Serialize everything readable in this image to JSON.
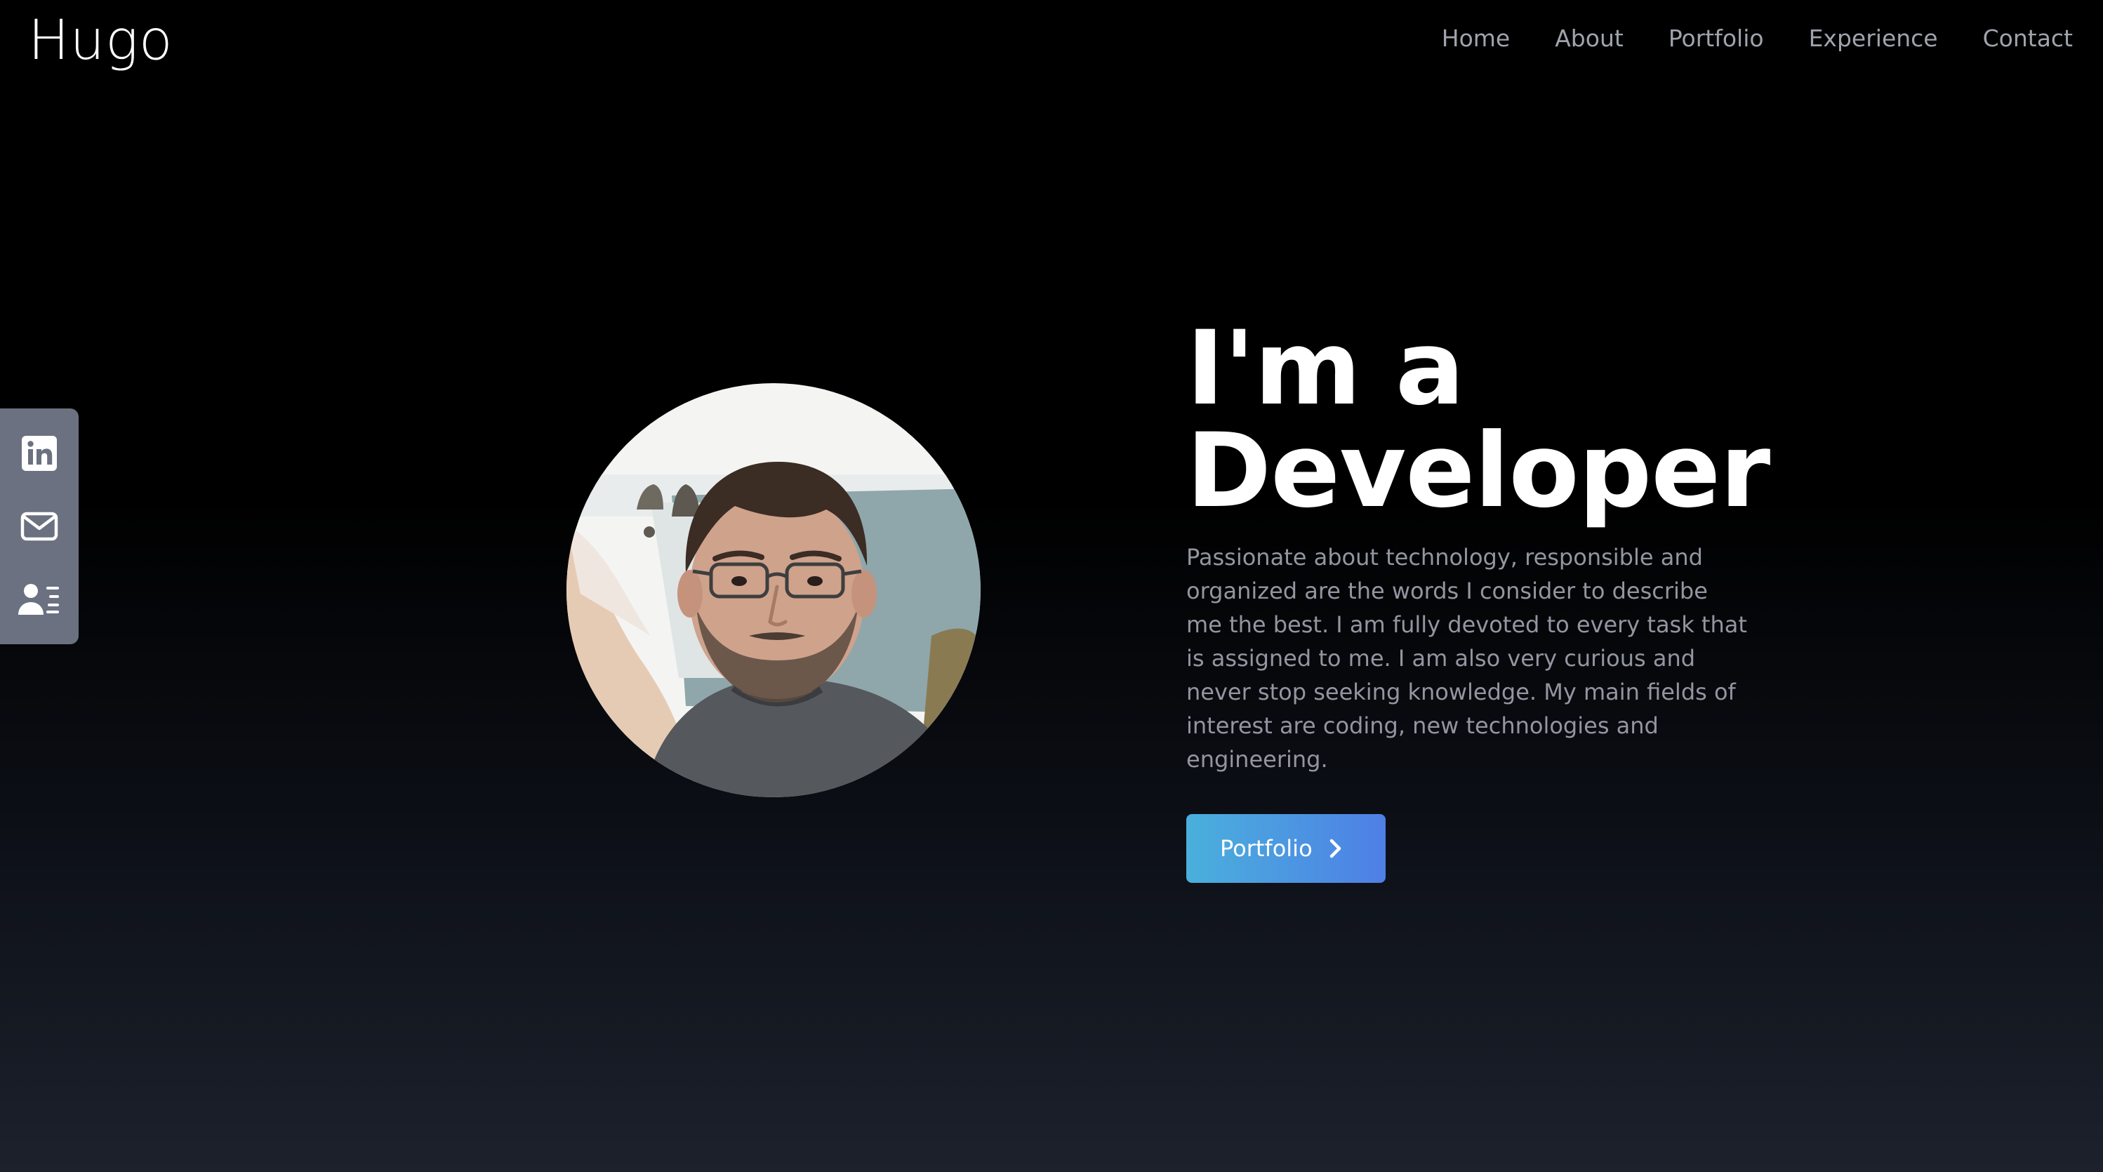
{
  "header": {
    "brand": "Hugo",
    "nav": [
      "Home",
      "About",
      "Portfolio",
      "Experience",
      "Contact"
    ]
  },
  "social": {
    "items": [
      {
        "icon": "linkedin-icon"
      },
      {
        "icon": "mail-icon"
      },
      {
        "icon": "contact-card-icon"
      }
    ]
  },
  "hero": {
    "headline_line1": "I'm a",
    "headline_line2": "Developer",
    "bio": "Passionate about technology, responsible and organized are the words I consider to describe me the best. I am fully devoted to every task that is assigned to me. I am also very curious and never stop seeking knowledge. My main fields of interest are coding, new technologies and engineering.",
    "cta_label": "Portfolio",
    "cta_icon": "chevron-right-icon"
  },
  "colors": {
    "background_top": "#000000",
    "background_bottom": "#1c212c",
    "nav_text": "#9fa3ab",
    "bio_text": "#9296a0",
    "sidebar": "#6b7180",
    "cta_gradient_start": "#4ab0dc",
    "cta_gradient_end": "#4e7fe6"
  }
}
